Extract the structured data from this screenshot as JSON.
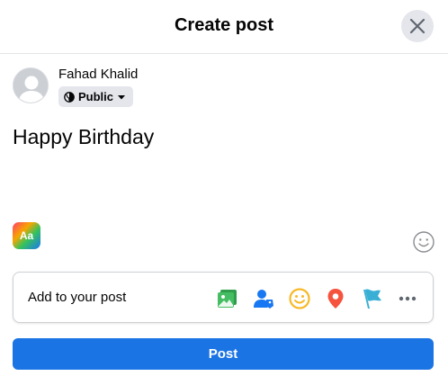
{
  "dialog": {
    "title": "Create post"
  },
  "author": {
    "name": "Fahad Khalid",
    "audience": "Public"
  },
  "composer": {
    "text": "Happy Birthday",
    "bg_picker_label": "Aa"
  },
  "add_to_post": {
    "label": "Add to your post",
    "icons": [
      "photo-video-icon",
      "tag-people-icon",
      "feeling-icon",
      "check-in-icon",
      "life-event-icon",
      "more-icon"
    ]
  },
  "actions": {
    "post_label": "Post"
  },
  "colors": {
    "accent": "#1b74e4",
    "photo": "#45bd62",
    "tag": "#1877f2",
    "feeling": "#f7b928",
    "checkin": "#f5533d",
    "flag": "#39afd5"
  }
}
